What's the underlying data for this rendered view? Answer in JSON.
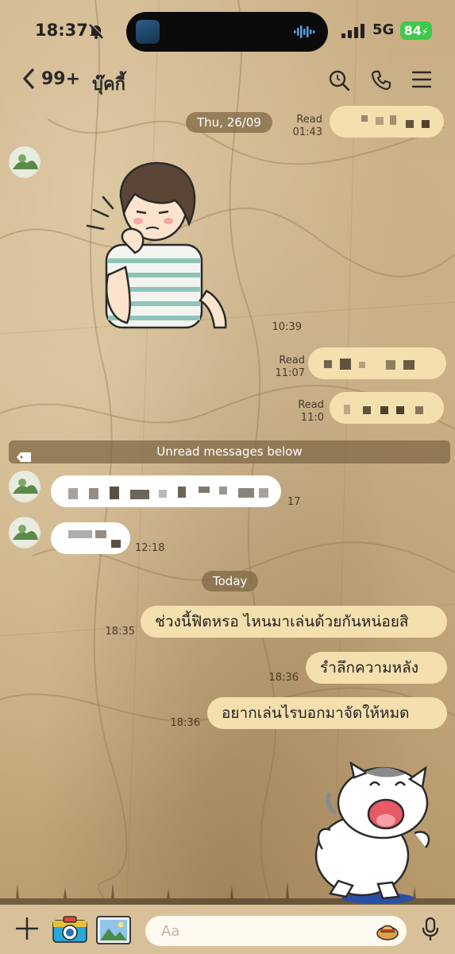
{
  "status_bar": {
    "time": "18:37",
    "network": "5G",
    "battery": "84"
  },
  "header": {
    "unread_count": "99+",
    "chat_name": "บุ๊คกี้"
  },
  "messages": {
    "date_thu": "Thu, 26/09",
    "read1": {
      "status": "Read",
      "time": "01:43"
    },
    "sticker1_time": "10:39",
    "read2": {
      "status": "Read",
      "time": "11:07"
    },
    "read3": {
      "status": "Read",
      "time": "11:0"
    },
    "unread_banner": "Unread messages below",
    "in1_time": "17",
    "in2_time": "12:18",
    "date_today": "Today",
    "out1": {
      "text": "ช่วงนี้ฟิตหรอ ไหนมาเล่นด้วยกันหน่อยสิ",
      "time": "18:35"
    },
    "out2": {
      "text": "รำลึกความหลัง",
      "time": "18:36"
    },
    "out3": {
      "text": "อยากเล่นไรบอกมาจัดให้หมด",
      "time": "18:36"
    }
  },
  "input": {
    "placeholder": "Aa"
  },
  "colors": {
    "outgoing_bubble": "#f4dfae",
    "incoming_bubble": "#ffffff",
    "pill": "#806846",
    "battery": "#3fc94a"
  }
}
